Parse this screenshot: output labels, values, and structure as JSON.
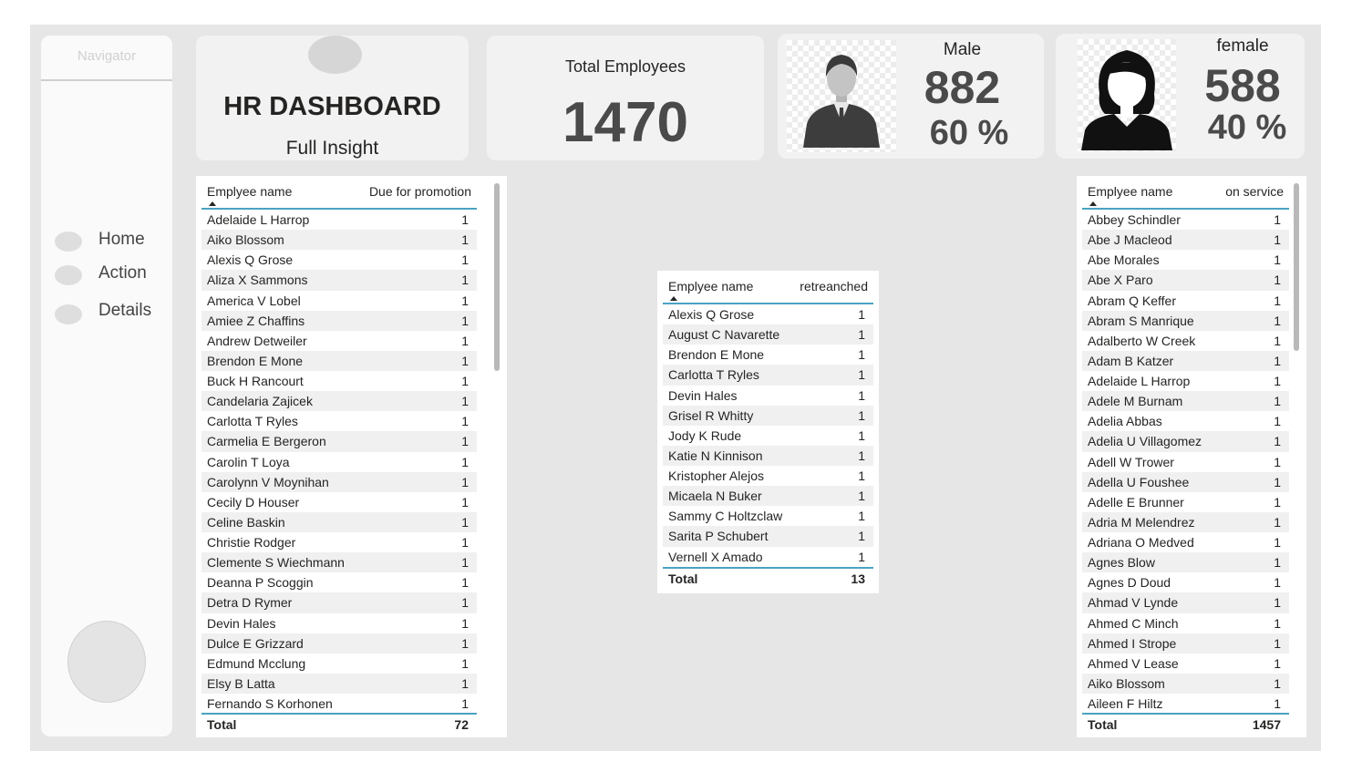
{
  "navigator": {
    "title": "Navigator",
    "items": [
      {
        "label": "Home"
      },
      {
        "label": "Action"
      },
      {
        "label": "Details"
      }
    ]
  },
  "header": {
    "title": "HR DASHBOARD",
    "subtitle": "Full Insight"
  },
  "total_employees": {
    "label": "Total Employees",
    "value": "1470"
  },
  "male": {
    "label": "Male",
    "count": "882",
    "percent": "60 %",
    "icon": "male-person-icon"
  },
  "female": {
    "label": "female",
    "count": "588",
    "percent": "40 %",
    "icon": "female-person-icon"
  },
  "promotion_table": {
    "col_name": "Emplyee name",
    "col_value": "Due for promotion",
    "rows": [
      [
        "Adelaide L Harrop",
        "1"
      ],
      [
        "Aiko Blossom",
        "1"
      ],
      [
        "Alexis Q Grose",
        "1"
      ],
      [
        "Aliza X Sammons",
        "1"
      ],
      [
        "America V Lobel",
        "1"
      ],
      [
        "Amiee Z Chaffins",
        "1"
      ],
      [
        "Andrew Detweiler",
        "1"
      ],
      [
        "Brendon E Mone",
        "1"
      ],
      [
        "Buck H Rancourt",
        "1"
      ],
      [
        "Candelaria Zajicek",
        "1"
      ],
      [
        "Carlotta T Ryles",
        "1"
      ],
      [
        "Carmelia E Bergeron",
        "1"
      ],
      [
        "Carolin T Loya",
        "1"
      ],
      [
        "Carolynn V Moynihan",
        "1"
      ],
      [
        "Cecily D Houser",
        "1"
      ],
      [
        "Celine Baskin",
        "1"
      ],
      [
        "Christie Rodger",
        "1"
      ],
      [
        "Clemente S Wiechmann",
        "1"
      ],
      [
        "Deanna P Scoggin",
        "1"
      ],
      [
        "Detra D Rymer",
        "1"
      ],
      [
        "Devin Hales",
        "1"
      ],
      [
        "Dulce E Grizzard",
        "1"
      ],
      [
        "Edmund Mcclung",
        "1"
      ],
      [
        "Elsy B Latta",
        "1"
      ],
      [
        "Fernando S Korhonen",
        "1"
      ]
    ],
    "total_label": "Total",
    "total_value": "72"
  },
  "retrenched_table": {
    "col_name": "Emplyee name",
    "col_value": "retreanched",
    "rows": [
      [
        "Alexis Q Grose",
        "1"
      ],
      [
        "August C Navarette",
        "1"
      ],
      [
        "Brendon E Mone",
        "1"
      ],
      [
        "Carlotta T Ryles",
        "1"
      ],
      [
        "Devin Hales",
        "1"
      ],
      [
        "Grisel R Whitty",
        "1"
      ],
      [
        "Jody K Rude",
        "1"
      ],
      [
        "Katie N Kinnison",
        "1"
      ],
      [
        "Kristopher Alejos",
        "1"
      ],
      [
        "Micaela N Buker",
        "1"
      ],
      [
        "Sammy C Holtzclaw",
        "1"
      ],
      [
        "Sarita P Schubert",
        "1"
      ],
      [
        "Vernell X Amado",
        "1"
      ]
    ],
    "total_label": "Total",
    "total_value": "13"
  },
  "service_table": {
    "col_name": "Emplyee name",
    "col_value": "on service",
    "rows": [
      [
        "Abbey Schindler",
        "1"
      ],
      [
        "Abe J Macleod",
        "1"
      ],
      [
        "Abe Morales",
        "1"
      ],
      [
        "Abe X Paro",
        "1"
      ],
      [
        "Abram Q Keffer",
        "1"
      ],
      [
        "Abram S Manrique",
        "1"
      ],
      [
        "Adalberto W Creek",
        "1"
      ],
      [
        "Adam B Katzer",
        "1"
      ],
      [
        "Adelaide L Harrop",
        "1"
      ],
      [
        "Adele M Burnam",
        "1"
      ],
      [
        "Adelia Abbas",
        "1"
      ],
      [
        "Adelia U Villagomez",
        "1"
      ],
      [
        "Adell W Trower",
        "1"
      ],
      [
        "Adella U Foushee",
        "1"
      ],
      [
        "Adelle E Brunner",
        "1"
      ],
      [
        "Adria M Melendrez",
        "1"
      ],
      [
        "Adriana O Medved",
        "1"
      ],
      [
        "Agnes Blow",
        "1"
      ],
      [
        "Agnes D Doud",
        "1"
      ],
      [
        "Ahmad V Lynde",
        "1"
      ],
      [
        "Ahmed C Minch",
        "1"
      ],
      [
        "Ahmed I Strope",
        "1"
      ],
      [
        "Ahmed V Lease",
        "1"
      ],
      [
        "Aiko Blossom",
        "1"
      ],
      [
        "Aileen F Hiltz",
        "1"
      ]
    ],
    "total_label": "Total",
    "total_value": "1457"
  }
}
